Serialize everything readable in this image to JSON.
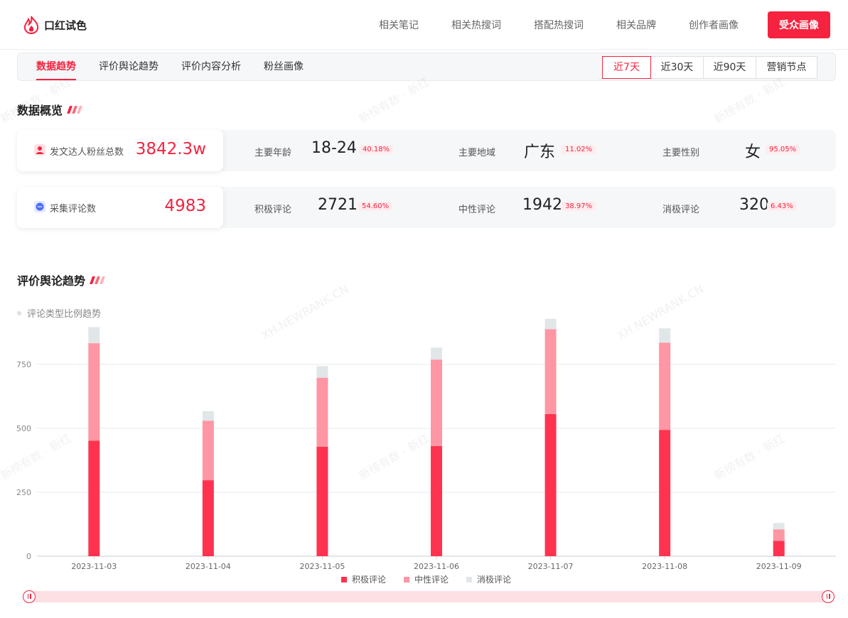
{
  "brand": {
    "name": "口红试色",
    "icon": "flame-logo-icon"
  },
  "topnav": [
    "相关笔记",
    "相关热搜词",
    "搭配热搜词",
    "相关品牌",
    "创作者画像"
  ],
  "cta_label": "受众画像",
  "tabs": [
    "数据趋势",
    "评价舆论趋势",
    "评价内容分析",
    "粉丝画像"
  ],
  "active_tab": "数据趋势",
  "time_ranges": [
    "近7天",
    "近30天",
    "近90天",
    "营销节点"
  ],
  "active_range": "近7天",
  "overview": {
    "title": "数据概览",
    "fans": {
      "label": "发文达人粉丝总数",
      "value": "3842.3w",
      "icon": "user-icon",
      "metrics": [
        {
          "label": "主要年龄",
          "value": "18-24",
          "pct": "40.18%"
        },
        {
          "label": "主要地域",
          "value": "广东",
          "pct": "11.02%"
        },
        {
          "label": "主要性别",
          "value": "女",
          "pct": "95.05%"
        }
      ]
    },
    "comments": {
      "label": "采集评论数",
      "value": "4983",
      "icon": "chat-bubble-icon",
      "metrics": [
        {
          "label": "积极评论",
          "value": "2721",
          "pct": "54.60%"
        },
        {
          "label": "中性评论",
          "value": "1942",
          "pct": "38.97%"
        },
        {
          "label": "消极评论",
          "value": "320",
          "pct": "6.43%"
        }
      ]
    }
  },
  "trend": {
    "title": "评价舆论趋势",
    "subtitle": "评论类型比例趋势"
  },
  "watermarks": [
    "新榜有数 · 新红",
    "XH.NEWRANK.CN"
  ],
  "colors": {
    "accent": "#f5233f",
    "positive": "#ff3350",
    "neutral": "#ff96a4",
    "negative": "#e1e6e8"
  },
  "chart_data": {
    "type": "bar",
    "stacked": true,
    "categories": [
      "2023-11-03",
      "2023-11-04",
      "2023-11-05",
      "2023-11-06",
      "2023-11-07",
      "2023-11-08",
      "2023-11-09"
    ],
    "series": [
      {
        "name": "积极评论",
        "values": [
          452,
          297,
          428,
          431,
          556,
          494,
          60
        ]
      },
      {
        "name": "中性评论",
        "values": [
          381,
          233,
          270,
          338,
          332,
          341,
          45
        ]
      },
      {
        "name": "消极评论",
        "values": [
          63,
          37,
          45,
          47,
          40,
          56,
          25
        ]
      }
    ],
    "yticks": [
      0,
      250,
      500,
      750
    ],
    "ylim": [
      0,
      900
    ],
    "grid": true,
    "legend": "bottom-center"
  }
}
